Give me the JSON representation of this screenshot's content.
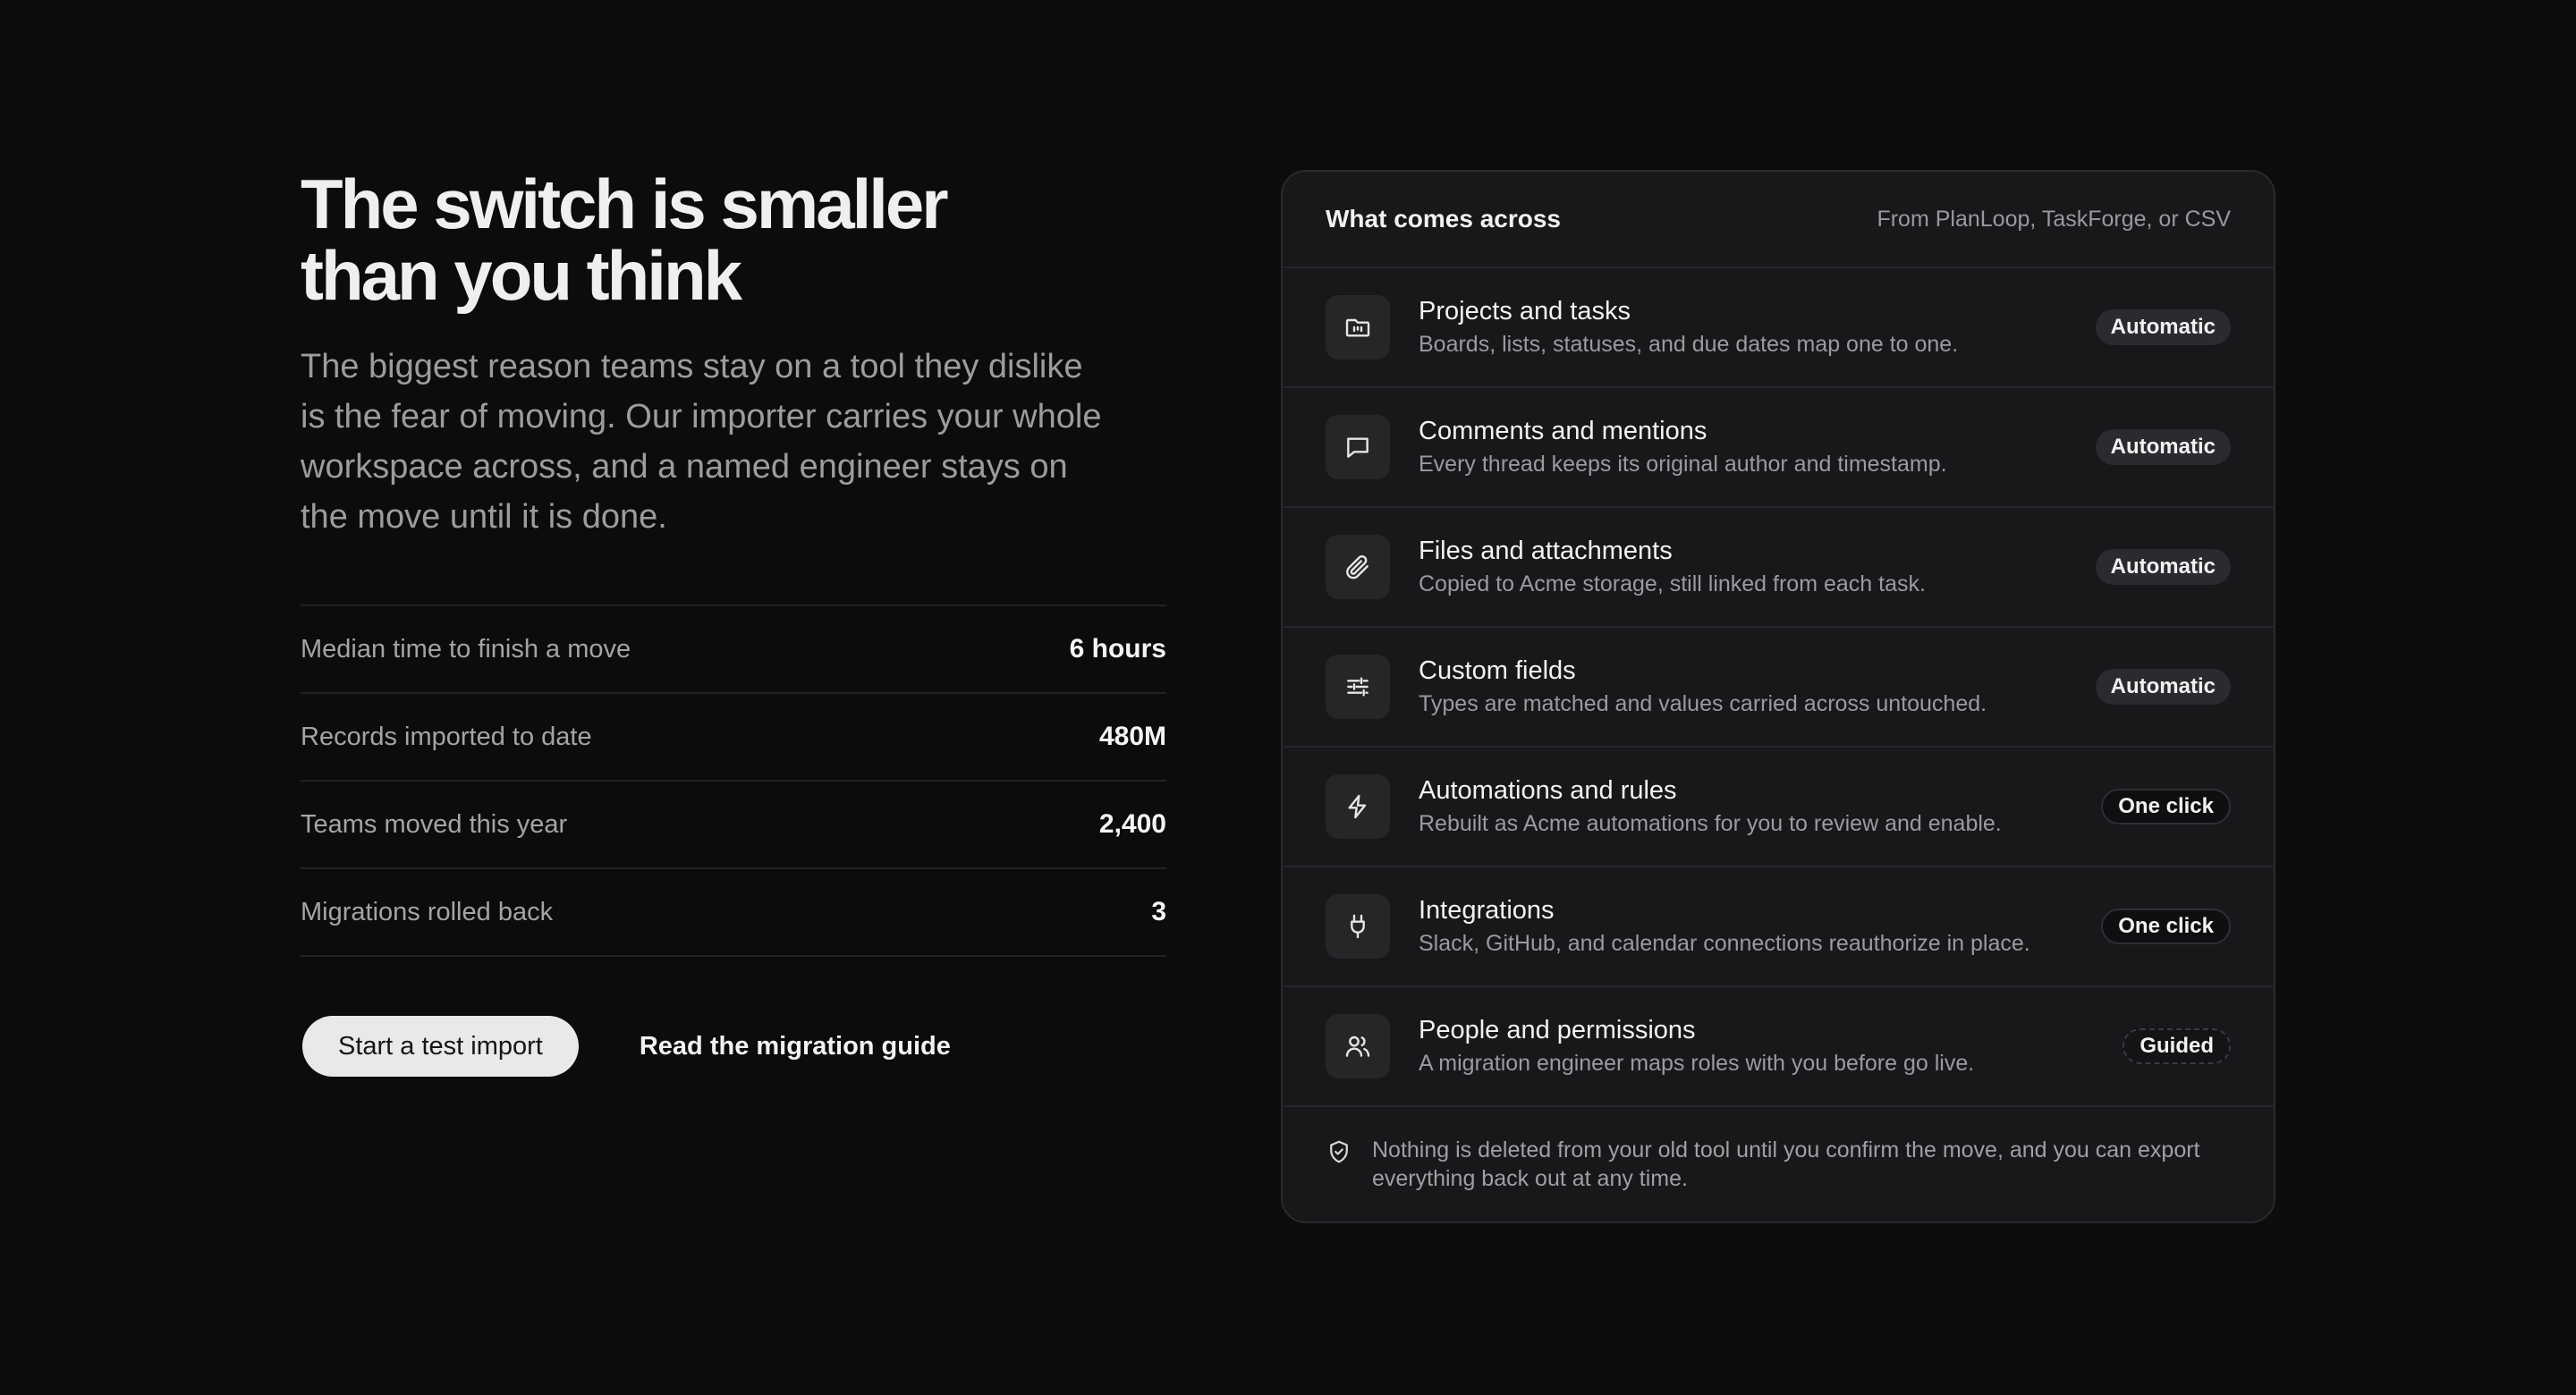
{
  "hero": {
    "headline_line1": "The switch is smaller",
    "headline_line2": "than you think",
    "lede": "The biggest reason teams stay on a tool they dislike is the fear of moving. Our importer carries your whole workspace across, and a named engineer stays on the move until it is done."
  },
  "stats": [
    {
      "label": "Median time to finish a move",
      "value": "6 hours"
    },
    {
      "label": "Records imported to date",
      "value": "480M"
    },
    {
      "label": "Teams moved this year",
      "value": "2,400"
    },
    {
      "label": "Migrations rolled back",
      "value": "3"
    }
  ],
  "cta": {
    "primary_label": "Start a test import",
    "secondary_label": "Read the migration guide"
  },
  "card": {
    "title": "What comes across",
    "source": "From PlanLoop, TaskForge, or CSV",
    "items": [
      {
        "icon": "folder-icon",
        "title": "Projects and tasks",
        "desc": "Boards, lists, statuses, and due dates map one to one.",
        "badge": "Automatic",
        "badge_type": "auto"
      },
      {
        "icon": "comment-icon",
        "title": "Comments and mentions",
        "desc": "Every thread keeps its original author and timestamp.",
        "badge": "Automatic",
        "badge_type": "auto"
      },
      {
        "icon": "paperclip-icon",
        "title": "Files and attachments",
        "desc": "Copied to Acme storage, still linked from each task.",
        "badge": "Automatic",
        "badge_type": "auto"
      },
      {
        "icon": "sliders-icon",
        "title": "Custom fields",
        "desc": "Types are matched and values carried across untouched.",
        "badge": "Automatic",
        "badge_type": "auto"
      },
      {
        "icon": "lightning-icon",
        "title": "Automations and rules",
        "desc": "Rebuilt as Acme automations for you to review and enable.",
        "badge": "One click",
        "badge_type": "click"
      },
      {
        "icon": "plug-icon",
        "title": "Integrations",
        "desc": "Slack, GitHub, and calendar connections reauthorize in place.",
        "badge": "One click",
        "badge_type": "click"
      },
      {
        "icon": "users-icon",
        "title": "People and permissions",
        "desc": "A migration engineer maps roles with you before go live.",
        "badge": "Guided",
        "badge_type": "guided"
      }
    ],
    "footer_icon": "shield-check-icon",
    "footer_text": "Nothing is deleted from your old tool until you confirm the move, and you can export everything back out at any time."
  }
}
